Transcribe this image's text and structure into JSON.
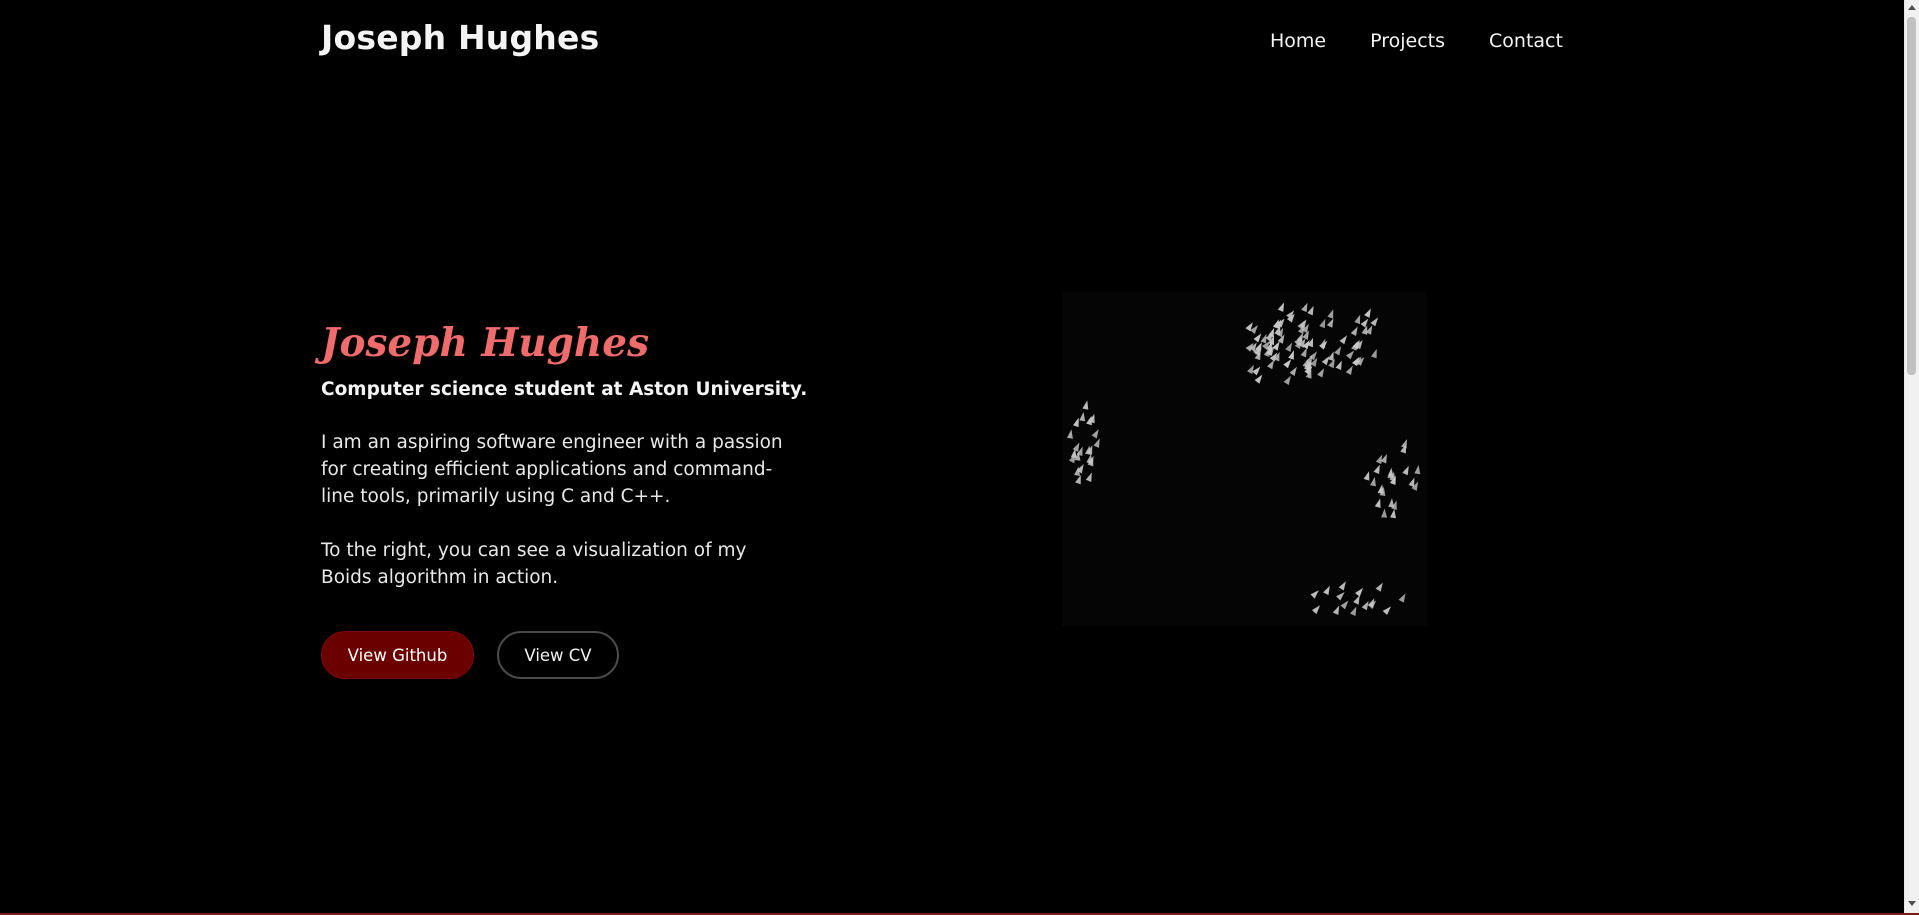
{
  "header": {
    "site_title": "Joseph Hughes",
    "nav": [
      {
        "label": "Home"
      },
      {
        "label": "Projects"
      },
      {
        "label": "Contact"
      }
    ]
  },
  "hero": {
    "name": "Joseph Hughes",
    "subtitle": "Computer science student at Aston University.",
    "paragraph_1": "I am an aspiring software engineer with a passion for creating efficient applications and command-line tools, primarily using C and C++.",
    "paragraph_2": "To the right, you can see a visualization of my Boids algorithm in action.",
    "github_button": "View Github",
    "cv_button": "View CV"
  },
  "boids_canvas": {
    "boid_color": "#c8c8c8"
  },
  "colors": {
    "background": "#000000",
    "accent_name": "#f06b6b",
    "primary_button": "#6b0000"
  }
}
